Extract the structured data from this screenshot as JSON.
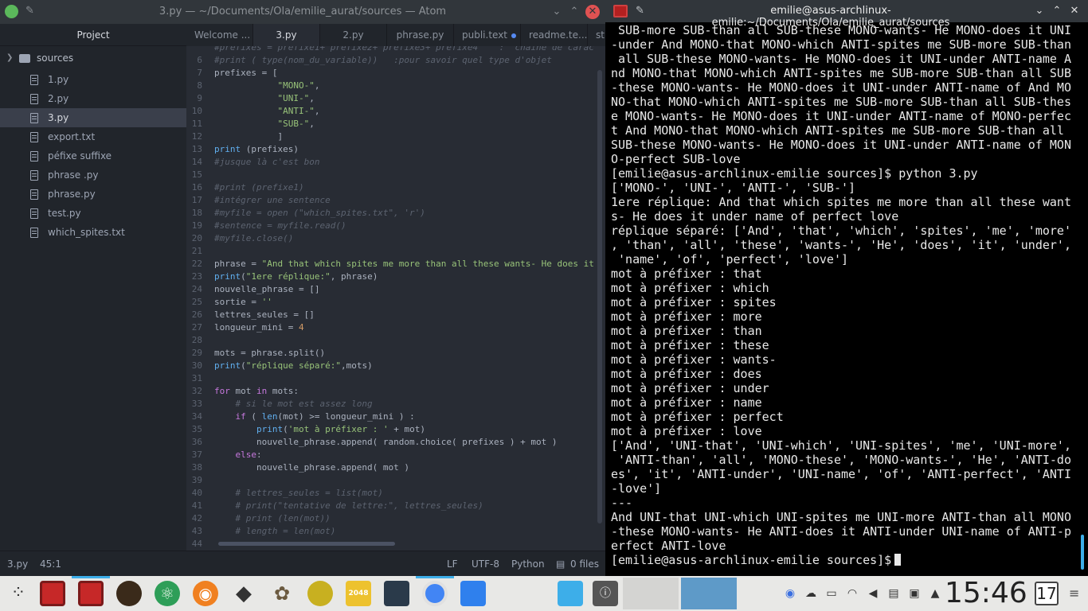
{
  "atom": {
    "title": "3.py — ~/Documents/Ola/emilie_aurat/sources — Atom",
    "tree": {
      "header": "Project",
      "root": "sources",
      "items": [
        "1.py",
        "2.py",
        "3.py",
        "export.txt",
        "péfixe suffixe",
        "phrase .py",
        "phrase.py",
        "test.py",
        "which_spites.txt"
      ]
    },
    "tabs": [
      {
        "label": "Welcome ..."
      },
      {
        "label": "3.py"
      },
      {
        "label": "2.py"
      },
      {
        "label": "phrase.py"
      },
      {
        "label": "publi.text"
      },
      {
        "label": "readme.te..."
      },
      {
        "label": "st"
      }
    ],
    "code_lines": [
      {
        "n": "",
        "t": "#prefixes = prefixe1+ prefixe2+ prefixe3+ prefixe4    :  chaine de carac"
      },
      {
        "n": "6",
        "t": "#print ( type(nom_du_variable))   :pour savoir quel type d'objet"
      },
      {
        "n": "7",
        "t": "prefixes = ["
      },
      {
        "n": "8",
        "t": "            \"MONO-\","
      },
      {
        "n": "9",
        "t": "            \"UNI-\","
      },
      {
        "n": "10",
        "t": "            \"ANTI-\","
      },
      {
        "n": "11",
        "t": "            \"SUB-\","
      },
      {
        "n": "12",
        "t": "            ]"
      },
      {
        "n": "13",
        "t": "print (prefixes)"
      },
      {
        "n": "14",
        "t": "#jusque là c'est bon"
      },
      {
        "n": "15",
        "t": ""
      },
      {
        "n": "16",
        "t": "#print (prefixe1)"
      },
      {
        "n": "17",
        "t": "#intégrer une sentence"
      },
      {
        "n": "18",
        "t": "#myfile = open (\"which_spites.txt\", 'r')"
      },
      {
        "n": "19",
        "t": "#sentence = myfile.read()"
      },
      {
        "n": "20",
        "t": "#myfile.close()"
      },
      {
        "n": "21",
        "t": ""
      },
      {
        "n": "22",
        "t": "phrase = \"And that which spites me more than all these wants- He does it"
      },
      {
        "n": "23",
        "t": "print(\"1ere réplique:\", phrase)"
      },
      {
        "n": "24",
        "t": "nouvelle_phrase = []"
      },
      {
        "n": "25",
        "t": "sortie = ''"
      },
      {
        "n": "26",
        "t": "lettres_seules = []"
      },
      {
        "n": "27",
        "t": "longueur_mini = 4"
      },
      {
        "n": "28",
        "t": ""
      },
      {
        "n": "29",
        "t": "mots = phrase.split()"
      },
      {
        "n": "30",
        "t": "print(\"réplique séparé:\",mots)"
      },
      {
        "n": "31",
        "t": ""
      },
      {
        "n": "32",
        "t": "for mot in mots:"
      },
      {
        "n": "33",
        "t": "    # si le mot est assez long"
      },
      {
        "n": "34",
        "t": "    if ( len(mot) >= longueur_mini ) :"
      },
      {
        "n": "35",
        "t": "        print('mot à préfixer : ' + mot)"
      },
      {
        "n": "36",
        "t": "        nouvelle_phrase.append( random.choice( prefixes ) + mot )"
      },
      {
        "n": "37",
        "t": "    else:"
      },
      {
        "n": "38",
        "t": "        nouvelle_phrase.append( mot )"
      },
      {
        "n": "39",
        "t": ""
      },
      {
        "n": "40",
        "t": "    # lettres_seules = list(mot)"
      },
      {
        "n": "41",
        "t": "    # print(\"tentative de lettre:\", lettres_seules)"
      },
      {
        "n": "42",
        "t": "    # print (len(mot))"
      },
      {
        "n": "43",
        "t": "    # length = len(mot)"
      },
      {
        "n": "44",
        "t": ""
      }
    ],
    "status": {
      "file": "3.py",
      "cursor": "45:1",
      "eol": "LF",
      "encoding": "UTF-8",
      "grammar": "Python",
      "files": "0 files"
    }
  },
  "terminal": {
    "title": "emilie@asus-archlinux-emilie:~/Documents/Ola/emilie_aurat/sources",
    "lines": [
      " SUB-more SUB-than all SUB-these MONO-wants- He MONO-does it UNI",
      "-under And MONO-that MONO-which ANTI-spites me SUB-more SUB-than",
      " all SUB-these MONO-wants- He MONO-does it UNI-under ANTI-name A",
      "nd MONO-that MONO-which ANTI-spites me SUB-more SUB-than all SUB",
      "-these MONO-wants- He MONO-does it UNI-under ANTI-name of And MO",
      "NO-that MONO-which ANTI-spites me SUB-more SUB-than all SUB-thes",
      "e MONO-wants- He MONO-does it UNI-under ANTI-name of MONO-perfec",
      "t And MONO-that MONO-which ANTI-spites me SUB-more SUB-than all",
      "SUB-these MONO-wants- He MONO-does it UNI-under ANTI-name of MON",
      "O-perfect SUB-love",
      "[emilie@asus-archlinux-emilie sources]$ python 3.py",
      "['MONO-', 'UNI-', 'ANTI-', 'SUB-']",
      "1ere réplique: And that which spites me more than all these want",
      "s- He does it under name of perfect love",
      "réplique séparé: ['And', 'that', 'which', 'spites', 'me', 'more'",
      ", 'than', 'all', 'these', 'wants-', 'He', 'does', 'it', 'under',",
      " 'name', 'of', 'perfect', 'love']",
      "mot à préfixer : that",
      "mot à préfixer : which",
      "mot à préfixer : spites",
      "mot à préfixer : more",
      "mot à préfixer : than",
      "mot à préfixer : these",
      "mot à préfixer : wants-",
      "mot à préfixer : does",
      "mot à préfixer : under",
      "mot à préfixer : name",
      "mot à préfixer : perfect",
      "mot à préfixer : love",
      "['And', 'UNI-that', 'UNI-which', 'UNI-spites', 'me', 'UNI-more',",
      " 'ANTI-than', 'all', 'MONO-these', 'MONO-wants-', 'He', 'ANTI-do",
      "es', 'it', 'ANTI-under', 'UNI-name', 'of', 'ANTI-perfect', 'ANTI",
      "-love']",
      "---",
      "And UNI-that UNI-which UNI-spites me UNI-more ANTI-than all MONO",
      "-these MONO-wants- He ANTI-does it ANTI-under UNI-name of ANTI-p",
      "erfect ANTI-love"
    ],
    "prompt": "[emilie@asus-archlinux-emilie sources]$"
  },
  "taskbar": {
    "clock": "15:46",
    "date": "17",
    "game_label": "2048"
  },
  "colors": {
    "accent": "#3daee9",
    "close": "#e05252",
    "editor_bg": "#282c34",
    "terminal_bg": "#000000"
  }
}
